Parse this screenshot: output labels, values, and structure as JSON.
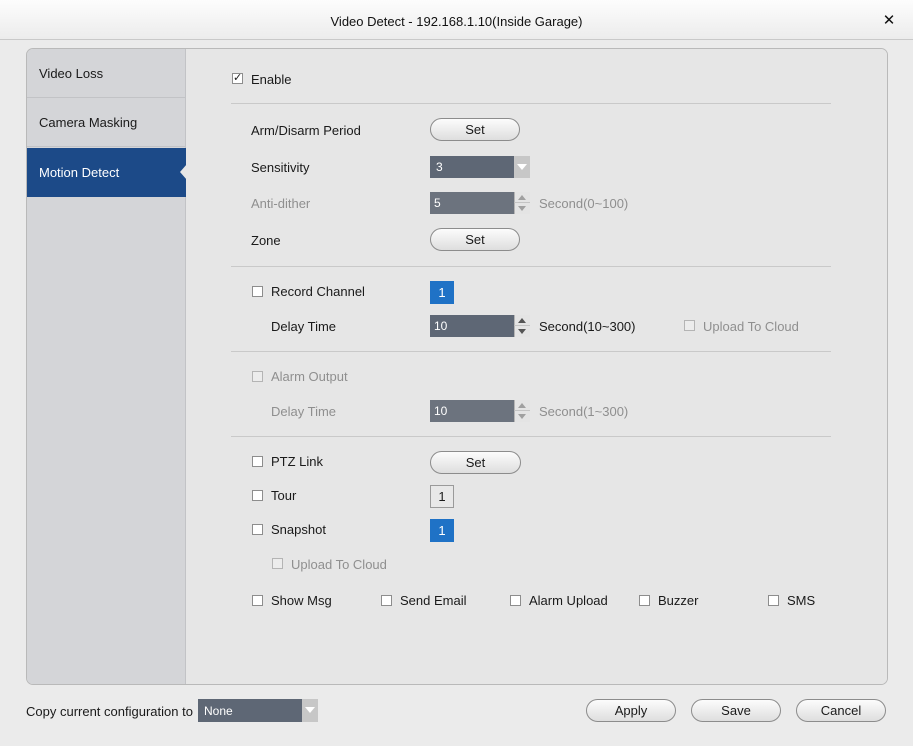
{
  "window": {
    "title": "Video Detect - 192.168.1.10(Inside Garage)"
  },
  "sidebar": {
    "items": [
      {
        "label": "Video Loss",
        "active": false
      },
      {
        "label": "Camera Masking",
        "active": false
      },
      {
        "label": "Motion Detect",
        "active": true
      }
    ]
  },
  "main": {
    "enable": {
      "label": "Enable",
      "checked": true
    },
    "arm_disarm": {
      "label": "Arm/Disarm Period",
      "button": "Set"
    },
    "sensitivity": {
      "label": "Sensitivity",
      "value": "3"
    },
    "anti_dither": {
      "label": "Anti-dither",
      "value": "5",
      "unit": "Second(0~100)"
    },
    "zone": {
      "label": "Zone",
      "button": "Set"
    },
    "record_channel": {
      "label": "Record Channel",
      "checked": false,
      "channel": "1"
    },
    "record_delay": {
      "label": "Delay Time",
      "value": "10",
      "unit": "Second(10~300)"
    },
    "upload_cloud_record": {
      "label": "Upload To Cloud",
      "checked": false
    },
    "alarm_output": {
      "label": "Alarm Output",
      "checked": false
    },
    "alarm_delay": {
      "label": "Delay Time",
      "value": "10",
      "unit": "Second(1~300)"
    },
    "ptz_link": {
      "label": "PTZ Link",
      "checked": false,
      "button": "Set"
    },
    "tour": {
      "label": "Tour",
      "checked": false,
      "channel": "1"
    },
    "snapshot": {
      "label": "Snapshot",
      "checked": false,
      "channel": "1"
    },
    "upload_cloud_snapshot": {
      "label": "Upload To Cloud",
      "checked": false
    },
    "show_msg": {
      "label": "Show Msg",
      "checked": false
    },
    "send_email": {
      "label": "Send Email",
      "checked": false
    },
    "alarm_upload": {
      "label": "Alarm Upload",
      "checked": false
    },
    "buzzer": {
      "label": "Buzzer",
      "checked": false
    },
    "sms": {
      "label": "SMS",
      "checked": false
    }
  },
  "footer": {
    "copy_label": "Copy current configuration to",
    "copy_value": "None",
    "apply": "Apply",
    "save": "Save",
    "cancel": "Cancel"
  },
  "colors": {
    "active_nav": "#1c4a88",
    "channel_blue": "#1f72c6",
    "control_gray": "#5e6775"
  }
}
